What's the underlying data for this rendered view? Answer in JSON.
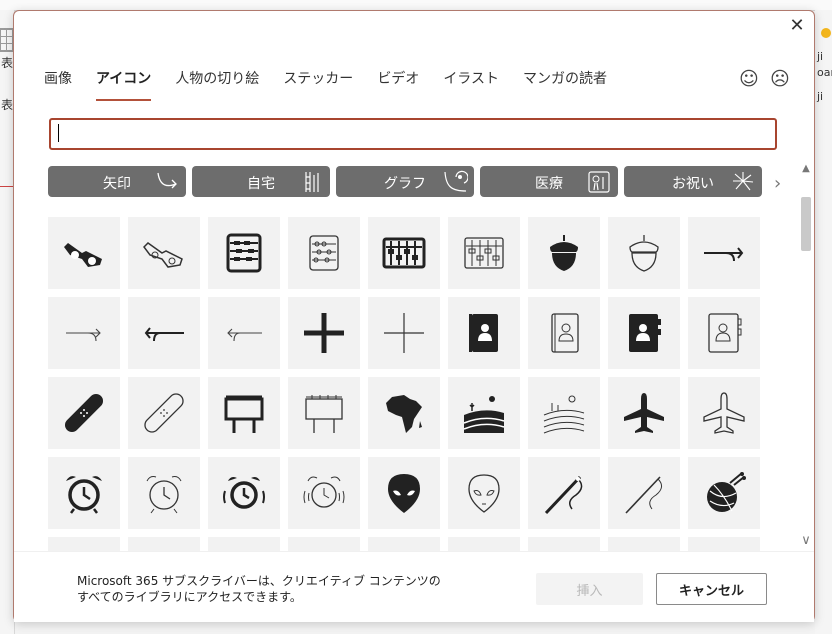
{
  "background_app": {
    "left_texts": [
      "表",
      "表"
    ],
    "right_texts": [
      "ji",
      "oard",
      "ji"
    ]
  },
  "dialog": {
    "close_glyph": "✕",
    "tabs": [
      {
        "label": "画像",
        "active": false
      },
      {
        "label": "アイコン",
        "active": true
      },
      {
        "label": "人物の切り絵",
        "active": false
      },
      {
        "label": "ステッカー",
        "active": false
      },
      {
        "label": "ビデオ",
        "active": false
      },
      {
        "label": "イラスト",
        "active": false
      },
      {
        "label": "マンガの読者",
        "active": false
      }
    ],
    "feedback": {
      "happy_glyph": "☺",
      "sad_glyph": "☹"
    },
    "search": {
      "value": "",
      "placeholder": ""
    },
    "categories": [
      {
        "label": "矢印",
        "icon": "arrow-icon"
      },
      {
        "label": "自宅",
        "icon": "home-icon"
      },
      {
        "label": "グラフ",
        "icon": "chart-icon"
      },
      {
        "label": "医療",
        "icon": "medical-icon"
      },
      {
        "label": "お祝い",
        "icon": "fireworks-icon"
      }
    ],
    "category_next_glyph": "›",
    "icons": [
      "3d-glasses-filled-icon",
      "3d-glasses-outline-icon",
      "abacus-filled-icon",
      "abacus-outline-icon",
      "abacus-wide-filled-icon",
      "abacus-wide-outline-icon",
      "acorn-filled-icon",
      "acorn-outline-icon",
      "curved-arrow-right-icon",
      "curved-arrow-right-thin-icon",
      "curved-arrow-left-icon",
      "curved-arrow-left-thin-icon",
      "plus-filled-icon",
      "plus-thin-icon",
      "address-book-filled-icon",
      "address-book-outline-icon",
      "address-book-dark-icon",
      "address-book-light-icon",
      "bandage-filled-icon",
      "bandage-outline-icon",
      "billboard-filled-icon",
      "billboard-outline-icon",
      "africa-icon",
      "farm-field-filled-icon",
      "farm-field-outline-icon",
      "airplane-filled-icon",
      "airplane-outline-icon",
      "alarm-clock-filled-icon",
      "alarm-clock-outline-icon",
      "alarm-ringing-filled-icon",
      "alarm-ringing-outline-icon",
      "alien-filled-icon",
      "alien-outline-icon",
      "needle-thread-filled-icon",
      "needle-thread-outline-icon",
      "yarn-ball-icon"
    ],
    "scroll": {
      "up_glyph": "▲",
      "down_glyph": "∨"
    },
    "footer": {
      "note_line1": "Microsoft 365 サブスクライバーは、クリエイティブ コンテンツの",
      "note_line2": "すべてのライブラリにアクセスできます。",
      "insert_label": "挿入",
      "cancel_label": "キャンセル"
    }
  },
  "colors": {
    "accent": "#b3513a",
    "category_bg": "#6d6d6d",
    "cell_bg": "#f2f2f2"
  }
}
